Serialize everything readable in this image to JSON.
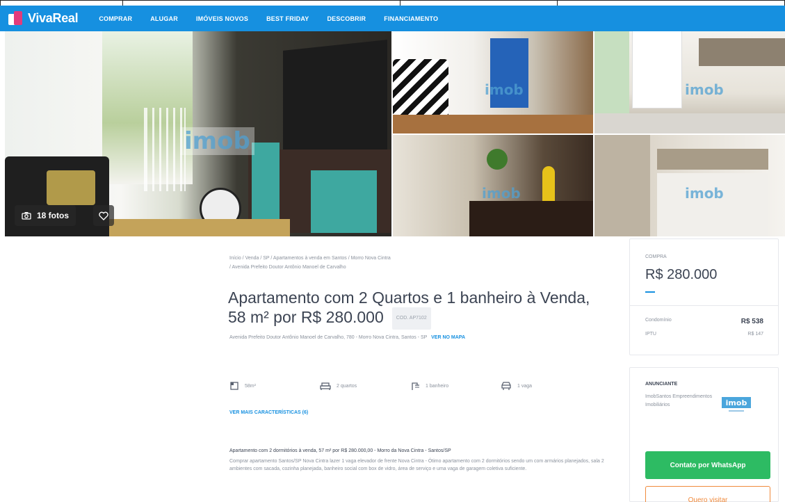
{
  "brand": {
    "name": "VivaReal",
    "color": "#1690e0",
    "accent": "#e23b7c"
  },
  "nav": {
    "items": [
      "COMPRAR",
      "ALUGAR",
      "IMÓVEIS NOVOS",
      "BEST FRIDAY",
      "DESCOBRIR",
      "FINANCIAMENTO"
    ]
  },
  "gallery": {
    "photos_label": "18 fotos",
    "watermark": "imob",
    "camera_icon": "camera-icon",
    "favorite_icon": "heart-icon"
  },
  "breadcrumb": {
    "line1": "Início / Venda / SP / Apartamentos à venda em Santos / Morro Nova Cintra",
    "line2": "/ Avenida Prefeito Doutor Antônio Manoel de Carvalho"
  },
  "listing": {
    "title": "Apartamento com 2 Quartos e 1 banheiro à Venda, 58 m² por R$ 280.000",
    "code": "COD. AP7102",
    "address": "Avenida Prefeito Doutor Antônio Manoel de Carvalho, 780 - Morro Nova Cintra, Santos - SP",
    "map_link": "VER NO MAPA",
    "features": [
      {
        "icon": "area-icon",
        "label": "58m²"
      },
      {
        "icon": "bed-icon",
        "label": "2 quartos"
      },
      {
        "icon": "shower-icon",
        "label": "1 banheiro"
      },
      {
        "icon": "car-icon",
        "label": "1 vaga"
      }
    ],
    "more_features": "VER MAIS CARACTERÍSTICAS (6)",
    "description_title": "Apartamento com 2 dormitórios à venda, 57 m² por R$ 280.000,00 - Morro da Nova Cintra - Santos/SP",
    "description": "Comprar apartamento Santos/SP Nova Cintra lazer 1 vaga elevador de frente Nova Cintra - Ótimo apartamento com 2 dormitórios sendo um com armários planejados, sala 2 ambientes com sacada, cozinha planejada, banheiro social com box de vidro, área de serviço e uma vaga de garagem coletiva suficiente."
  },
  "price": {
    "label": "COMPRA",
    "value": "R$ 280.000",
    "condo_label": "Condomínio",
    "condo_value": "R$ 538",
    "iptu_label": "IPTU",
    "iptu_value": "R$ 147"
  },
  "advertiser": {
    "label": "ANUNCIANTE",
    "name": "ImobSantos Empreendimentos Imobiliários",
    "logo_text": "imob"
  },
  "actions": {
    "whatsapp": "Contato por WhatsApp",
    "visit": "Quero visitar",
    "whatsapp_color": "#2dbb63",
    "visit_color": "#f08a3c"
  }
}
